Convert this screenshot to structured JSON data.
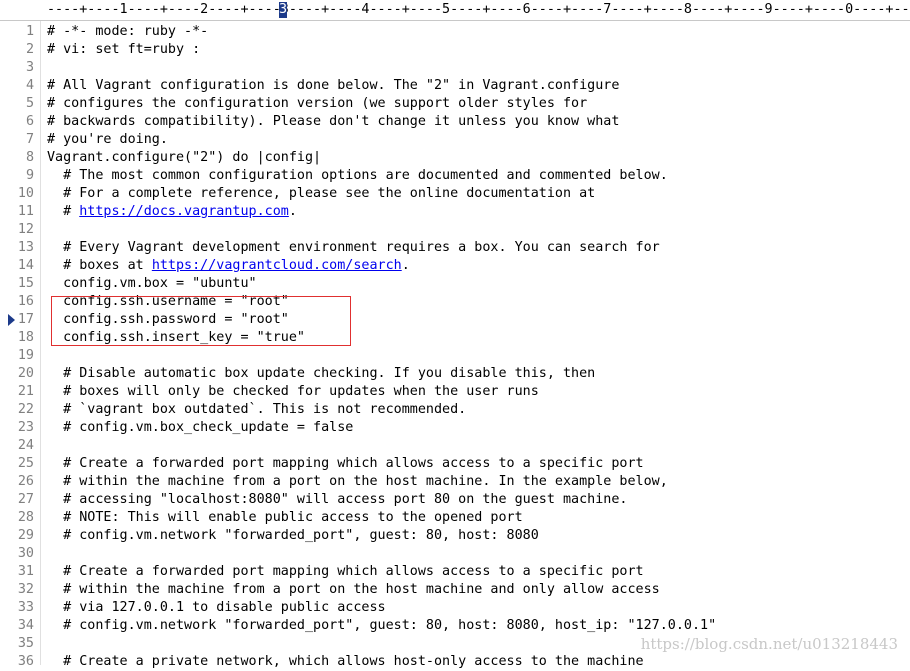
{
  "ruler": {
    "text": "----+----1----+----2----+----3----+----4----+----5----+----6----+----7----+----8----+----9----+----0----+--",
    "cursor_char": "3"
  },
  "editor": {
    "lines": [
      {
        "n": "1",
        "segments": [
          {
            "t": "# -*- mode: ruby -*-"
          }
        ]
      },
      {
        "n": "2",
        "segments": [
          {
            "t": "# vi: set ft=ruby :"
          }
        ]
      },
      {
        "n": "3",
        "segments": [
          {
            "t": ""
          }
        ]
      },
      {
        "n": "4",
        "segments": [
          {
            "t": "# All Vagrant configuration is done below. The \"2\" in Vagrant.configure"
          }
        ]
      },
      {
        "n": "5",
        "segments": [
          {
            "t": "# configures the configuration version (we support older styles for"
          }
        ]
      },
      {
        "n": "6",
        "segments": [
          {
            "t": "# backwards compatibility). Please don't change it unless you know what"
          }
        ]
      },
      {
        "n": "7",
        "segments": [
          {
            "t": "# you're doing."
          }
        ]
      },
      {
        "n": "8",
        "segments": [
          {
            "t": "Vagrant.configure(\"2\") do |config|"
          }
        ]
      },
      {
        "n": "9",
        "segments": [
          {
            "t": "  # The most common configuration options are documented and commented below."
          }
        ]
      },
      {
        "n": "10",
        "segments": [
          {
            "t": "  # For a complete reference, please see the online documentation at"
          }
        ]
      },
      {
        "n": "11",
        "segments": [
          {
            "t": "  # "
          },
          {
            "t": "https://docs.vagrantup.com",
            "link": true
          },
          {
            "t": "."
          }
        ]
      },
      {
        "n": "12",
        "segments": [
          {
            "t": ""
          }
        ]
      },
      {
        "n": "13",
        "segments": [
          {
            "t": "  # Every Vagrant development environment requires a box. You can search for"
          }
        ]
      },
      {
        "n": "14",
        "segments": [
          {
            "t": "  # boxes at "
          },
          {
            "t": "https://vagrantcloud.com/search",
            "link": true
          },
          {
            "t": "."
          }
        ]
      },
      {
        "n": "15",
        "segments": [
          {
            "t": "  config.vm.box = \"ubuntu\""
          }
        ]
      },
      {
        "n": "16",
        "segments": [
          {
            "t": "  config.ssh.username = \"root\""
          }
        ]
      },
      {
        "n": "17",
        "segments": [
          {
            "t": "  config.ssh.password = \"root\""
          }
        ],
        "marker": true
      },
      {
        "n": "18",
        "segments": [
          {
            "t": "  config.ssh.insert_key = \"true\""
          }
        ]
      },
      {
        "n": "19",
        "segments": [
          {
            "t": ""
          }
        ]
      },
      {
        "n": "20",
        "segments": [
          {
            "t": "  # Disable automatic box update checking. If you disable this, then"
          }
        ]
      },
      {
        "n": "21",
        "segments": [
          {
            "t": "  # boxes will only be checked for updates when the user runs"
          }
        ]
      },
      {
        "n": "22",
        "segments": [
          {
            "t": "  # `vagrant box outdated`. This is not recommended."
          }
        ]
      },
      {
        "n": "23",
        "segments": [
          {
            "t": "  # config.vm.box_check_update = false"
          }
        ]
      },
      {
        "n": "24",
        "segments": [
          {
            "t": ""
          }
        ]
      },
      {
        "n": "25",
        "segments": [
          {
            "t": "  # Create a forwarded port mapping which allows access to a specific port"
          }
        ]
      },
      {
        "n": "26",
        "segments": [
          {
            "t": "  # within the machine from a port on the host machine. In the example below,"
          }
        ]
      },
      {
        "n": "27",
        "segments": [
          {
            "t": "  # accessing \"localhost:8080\" will access port 80 on the guest machine."
          }
        ]
      },
      {
        "n": "28",
        "segments": [
          {
            "t": "  # NOTE: This will enable public access to the opened port"
          }
        ]
      },
      {
        "n": "29",
        "segments": [
          {
            "t": "  # config.vm.network \"forwarded_port\", guest: 80, host: 8080"
          }
        ]
      },
      {
        "n": "30",
        "segments": [
          {
            "t": ""
          }
        ]
      },
      {
        "n": "31",
        "segments": [
          {
            "t": "  # Create a forwarded port mapping which allows access to a specific port"
          }
        ]
      },
      {
        "n": "32",
        "segments": [
          {
            "t": "  # within the machine from a port on the host machine and only allow access"
          }
        ]
      },
      {
        "n": "33",
        "segments": [
          {
            "t": "  # via 127.0.0.1 to disable public access"
          }
        ]
      },
      {
        "n": "34",
        "segments": [
          {
            "t": "  # config.vm.network \"forwarded_port\", guest: 80, host: 8080, host_ip: \"127.0.0.1\""
          }
        ]
      },
      {
        "n": "35",
        "segments": [
          {
            "t": ""
          }
        ]
      },
      {
        "n": "36",
        "segments": [
          {
            "t": "  # Create a private network, which allows host-only access to the machine"
          }
        ]
      }
    ]
  },
  "watermark": "https://blog.csdn.net/u013218443"
}
